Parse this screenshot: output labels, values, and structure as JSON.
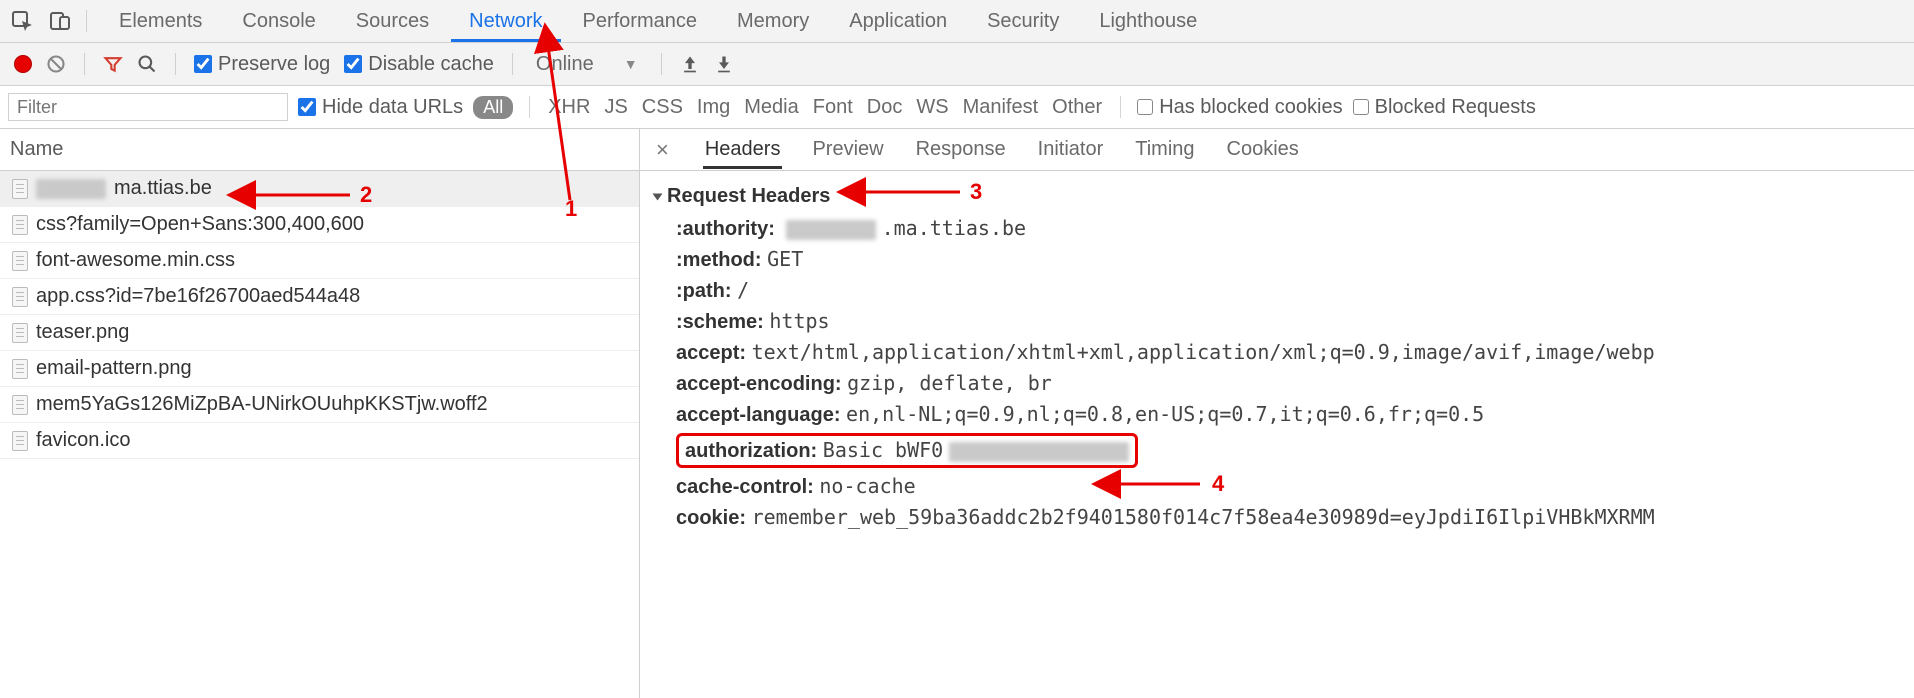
{
  "tabs": {
    "items": [
      "Elements",
      "Console",
      "Sources",
      "Network",
      "Performance",
      "Memory",
      "Application",
      "Security",
      "Lighthouse"
    ],
    "active": "Network"
  },
  "toolbar2": {
    "preserve_log": "Preserve log",
    "disable_cache": "Disable cache",
    "throttle": "Online"
  },
  "toolbar3": {
    "filter_placeholder": "Filter",
    "hide_data_urls": "Hide data URLs",
    "all_label": "All",
    "types": [
      "XHR",
      "JS",
      "CSS",
      "Img",
      "Media",
      "Font",
      "Doc",
      "WS",
      "Manifest",
      "Other"
    ],
    "has_blocked": "Has blocked cookies",
    "blocked_req": "Blocked Requests"
  },
  "left": {
    "header": "Name",
    "requests": [
      {
        "name_suffix": "ma.ttias.be",
        "blurred": true
      },
      {
        "name": "css?family=Open+Sans:300,400,600"
      },
      {
        "name": "font-awesome.min.css"
      },
      {
        "name": "app.css?id=7be16f26700aed544a48"
      },
      {
        "name": "teaser.png"
      },
      {
        "name": "email-pattern.png"
      },
      {
        "name": "mem5YaGs126MiZpBA-UNirkOUuhpKKSTjw.woff2"
      },
      {
        "name": "favicon.ico"
      }
    ]
  },
  "right": {
    "tabs": [
      "Headers",
      "Preview",
      "Response",
      "Initiator",
      "Timing",
      "Cookies"
    ],
    "active": "Headers",
    "section": "Request Headers",
    "headers": {
      "authority_label": ":authority:",
      "authority_value_suffix": ".ma.ttias.be",
      "method_label": ":method:",
      "method_value": "GET",
      "path_label": ":path:",
      "path_value": "/",
      "scheme_label": ":scheme:",
      "scheme_value": "https",
      "accept_label": "accept:",
      "accept_value": "text/html,application/xhtml+xml,application/xml;q=0.9,image/avif,image/webp",
      "accept_encoding_label": "accept-encoding:",
      "accept_encoding_value": "gzip, deflate, br",
      "accept_language_label": "accept-language:",
      "accept_language_value": "en,nl-NL;q=0.9,nl;q=0.8,en-US;q=0.7,it;q=0.6,fr;q=0.5",
      "authorization_label": "authorization:",
      "authorization_value_prefix": "Basic bWF0",
      "cache_control_label": "cache-control:",
      "cache_control_value": "no-cache",
      "cookie_label": "cookie:",
      "cookie_value": "remember_web_59ba36addc2b2f9401580f014c7f58ea4e30989d=eyJpdiI6IlpiVHBkMXRMM"
    }
  },
  "annotations": {
    "a1": "1",
    "a2": "2",
    "a3": "3",
    "a4": "4"
  }
}
